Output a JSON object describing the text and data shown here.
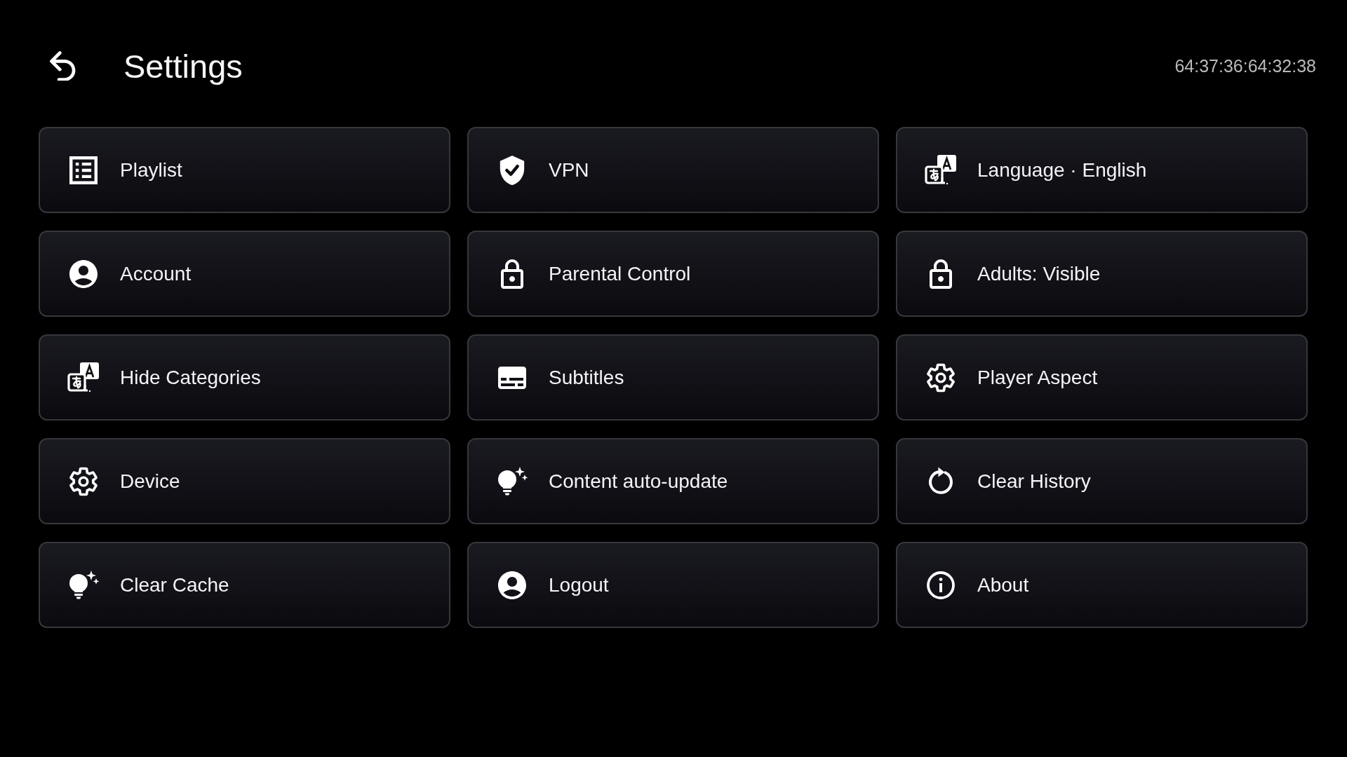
{
  "header": {
    "title": "Settings",
    "clock": "64:37:36:64:32:38"
  },
  "items": [
    {
      "label": "Playlist"
    },
    {
      "label": "VPN"
    },
    {
      "label": "Language · English"
    },
    {
      "label": "Account"
    },
    {
      "label": "Parental Control"
    },
    {
      "label": "Adults: Visible"
    },
    {
      "label": "Hide Categories"
    },
    {
      "label": "Subtitles"
    },
    {
      "label": "Player Aspect"
    },
    {
      "label": "Device"
    },
    {
      "label": "Content auto-update"
    },
    {
      "label": "Clear History"
    },
    {
      "label": "Clear Cache"
    },
    {
      "label": "Logout"
    },
    {
      "label": "About"
    }
  ]
}
